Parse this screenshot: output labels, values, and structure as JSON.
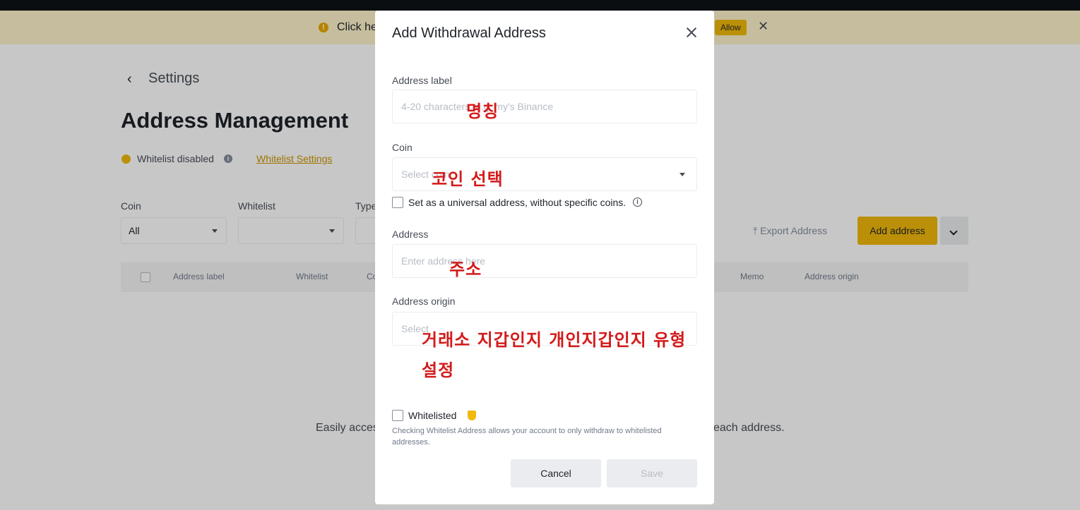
{
  "notice": {
    "text": "Click he",
    "allow_label": "Allow",
    "close_glyph": "✕"
  },
  "page": {
    "back_glyph": "‹",
    "settings_label": "Settings",
    "title": "Address Management",
    "whitelist_status": "Whitelist disabled",
    "whitelist_settings_link": "Whitelist Settings",
    "filters": {
      "coin_label": "Coin",
      "coin_value": "All",
      "whitelist_label": "Whitelist",
      "whitelist_value": "",
      "type_label": "Type"
    },
    "export_label": "⤒ Export Address",
    "add_address_label": "Add address",
    "table_headers": [
      "Address label",
      "Whitelist",
      "Co",
      "Memo",
      "Address origin"
    ],
    "empty_text_left": "Easily acces",
    "empty_text_right": "each address."
  },
  "modal": {
    "title": "Add Withdrawal Address",
    "address_label": {
      "label": "Address label",
      "placeholder": "4-20 characters, e.g. my's Binance"
    },
    "coin": {
      "label": "Coin",
      "placeholder": "Select coin"
    },
    "universal": {
      "label": "Set as a universal address, without specific coins."
    },
    "address": {
      "label": "Address",
      "placeholder": "Enter address here"
    },
    "address_origin": {
      "label": "Address origin",
      "placeholder": "Select"
    },
    "whitelisted": {
      "label": "Whitelisted",
      "help": "Checking Whitelist Address allows your account to only withdraw to whitelisted addresses."
    },
    "cancel_label": "Cancel",
    "save_label": "Save"
  },
  "annotations": {
    "label_note": "명칭",
    "coin_note": "코인 선택",
    "address_note": "주소",
    "origin_note_line1": "거래소 지갑인지 개인지갑인지 유형",
    "origin_note_line2": "설정"
  },
  "colors": {
    "brand": "#f0b90b",
    "annotation": "#d41a1a",
    "link": "#c99400"
  }
}
